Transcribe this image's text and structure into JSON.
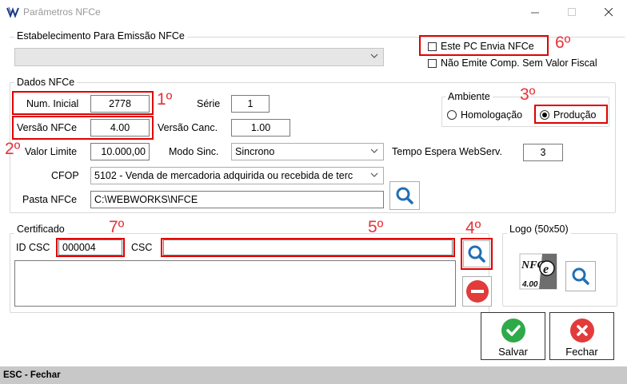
{
  "window": {
    "title": "Parâmetros NFCe",
    "controls": [
      "minimize-icon",
      "maximize-icon",
      "close-icon"
    ]
  },
  "estabelecimento": {
    "legend": "Estabelecimento Para Emissão NFCe",
    "value": ""
  },
  "flags": {
    "este_pc_envia": "Este PC Envia NFCe",
    "nao_emite": "Não Emite Comp. Sem Valor Fiscal"
  },
  "dados": {
    "legend": "Dados NFCe",
    "num_inicial_label": "Num. Inicial",
    "num_inicial": "2778",
    "serie_label": "Série",
    "serie": "1",
    "versao_label": "Versão NFCe",
    "versao": "4.00",
    "versao_canc_label": "Versão Canc.",
    "versao_canc": "1.00",
    "valor_limite_label": "Valor Limite",
    "valor_limite": "10.000,00",
    "modo_sinc_label": "Modo Sinc.",
    "modo_sinc": "Sincrono",
    "tempo_label": "Tempo Espera WebServ.",
    "tempo": "3",
    "cfop_label": "CFOP",
    "cfop": "5102 - Venda de mercadoria adquirida ou recebida de terc",
    "pasta_label": "Pasta NFCe",
    "pasta": "C:\\WEBWORKS\\NFCE"
  },
  "ambiente": {
    "legend": "Ambiente",
    "homologacao": "Homologação",
    "producao": "Produção",
    "selected": "producao"
  },
  "certificado": {
    "legend": "Certificado",
    "id_csc_label": "ID CSC",
    "id_csc": "000004",
    "csc_label": "CSC",
    "csc": ""
  },
  "logo": {
    "legend": "Logo (50x50)",
    "badge_text": "NFCe",
    "badge_version": "4.00"
  },
  "annotations": {
    "n1": "1º",
    "n2": "2º",
    "n3": "3º",
    "n4": "4º",
    "n5": "5º",
    "n6": "6º",
    "n7": "7º"
  },
  "buttons": {
    "salvar": "Salvar",
    "fechar": "Fechar"
  },
  "status": "ESC - Fechar",
  "colors": {
    "annotation": "#e00000",
    "search_blue": "#1f6fb5",
    "save_green": "#2faa4a",
    "close_red": "#e23b3b"
  }
}
